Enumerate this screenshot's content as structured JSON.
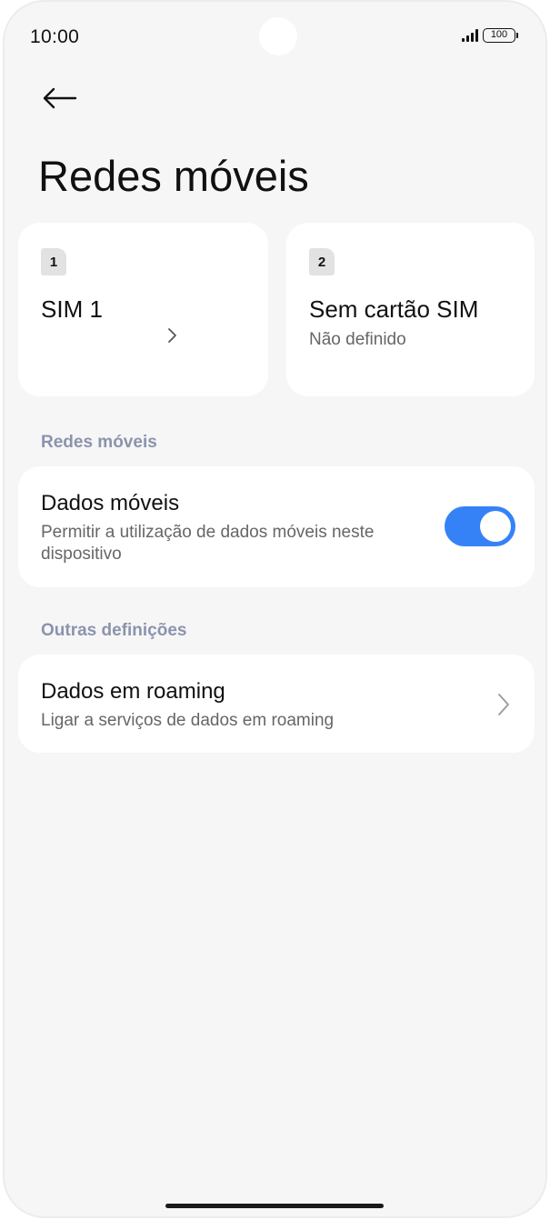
{
  "status_bar": {
    "time": "10:00",
    "battery_level": "100",
    "icons": [
      "signal-icon",
      "battery-icon"
    ]
  },
  "header": {
    "back_icon": "arrow-left-icon",
    "title": "Redes móveis"
  },
  "sim_cards": [
    {
      "slot": "1",
      "name": "SIM 1",
      "subtitle": "",
      "icon": "chevron-right-icon"
    },
    {
      "slot": "2",
      "name": "Sem cartão SIM",
      "subtitle": "Não definido"
    }
  ],
  "sections": {
    "mobile_networks": {
      "header": "Redes móveis",
      "mobile_data": {
        "title": "Dados móveis",
        "subtitle": "Permitir a utilização de dados móveis neste dispositivo",
        "enabled": true
      }
    },
    "other_settings": {
      "header": "Outras definições",
      "roaming": {
        "title": "Dados em roaming",
        "subtitle": "Ligar a serviços de dados em roaming",
        "icon": "chevron-right-icon"
      }
    }
  },
  "colors": {
    "accent": "#3482f6",
    "background": "#f6f6f6",
    "card": "#ffffff",
    "section_header": "#8c93ad"
  }
}
